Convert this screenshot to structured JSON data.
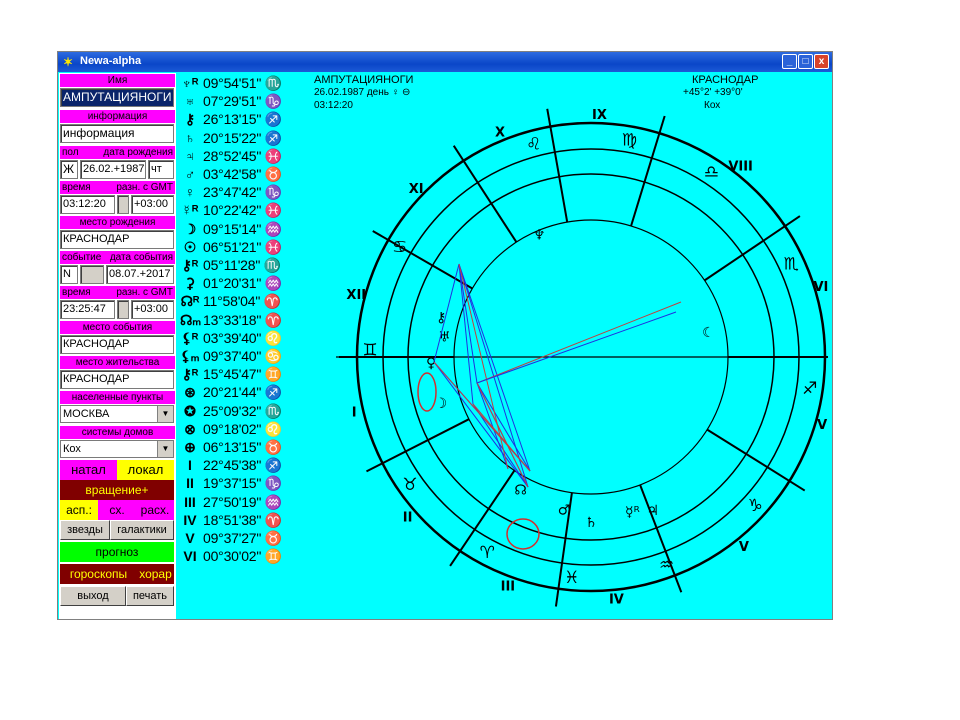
{
  "window": {
    "title": "Newa-alpha",
    "min_label": "_",
    "max_label": "□",
    "close_label": "x"
  },
  "left": {
    "name_label": "Имя",
    "name_value": "АМПУТАЦИЯНОГИ",
    "info_label": "информация",
    "info_value": "информация",
    "birth_label_sex": "пол",
    "birth_label_date": "дата рождения",
    "sex_value": "Ж",
    "date_value": "26.02.+1987",
    "weekday_value": "чт",
    "time_label": "время",
    "gmt_label": "разн. с GMT",
    "time_value": "03:12:20",
    "gmt_value": "+03:00",
    "birthplace_label": "место рождения",
    "birthplace_value": "КРАСНОДАР",
    "event_label": "событие",
    "event_date_label": "дата события",
    "event_value": "N",
    "event_date_value": "08.07.+2017",
    "event_time_label": "время",
    "event_gmt_label": "разн. с GMT",
    "event_time_value": "23:25:47",
    "event_gmt_value": "+03:00",
    "eventplace_label": "место события",
    "eventplace_value": "КРАСНОДАР",
    "residence_label": "место жительства",
    "residence_value": "КРАСНОДАР",
    "settlements_label": "населенные пункты",
    "settlements_value": "МОСКВА",
    "houses_label": "системы домов",
    "houses_value": "Кох",
    "natal": "натал",
    "local": "локал",
    "rotation": "вращение+",
    "asp": "асп.:",
    "sx": "сх.",
    "rasx": "расх.",
    "stars": "звезды",
    "galaxies": "галактики",
    "forecast": "прогноз",
    "horoscopes": "гороскопы",
    "horar": "хорар",
    "exit": "выход",
    "print": "печать"
  },
  "planets": [
    {
      "glyph": "♆ᴿ",
      "value": "09°54'51\" ♏"
    },
    {
      "glyph": "♅",
      "value": "07°29'51\" ♑"
    },
    {
      "glyph": "⚷",
      "value": "26°13'15\" ♐"
    },
    {
      "glyph": "♄",
      "value": "20°15'22\" ♐"
    },
    {
      "glyph": "♃",
      "value": "28°52'45\" ♓"
    },
    {
      "glyph": "♂",
      "value": "03°42'58\" ♉"
    },
    {
      "glyph": "♀",
      "value": "23°47'42\" ♑"
    },
    {
      "glyph": "☿ᴿ",
      "value": "10°22'42\" ♓"
    },
    {
      "glyph": "☽",
      "value": "09°15'14\" ♒"
    },
    {
      "glyph": "☉",
      "value": "06°51'21\" ♓"
    },
    {
      "glyph": "⚷ᴿ",
      "value": "05°11'28\" ♏"
    },
    {
      "glyph": "⚳",
      "value": "01°20'31\" ♒"
    },
    {
      "glyph": "☊ᴿ",
      "value": "11°58'04\" ♈"
    },
    {
      "glyph": "☊ₘ",
      "value": "13°33'18\" ♈"
    },
    {
      "glyph": "⚸ᴿ",
      "value": "03°39'40\" ♌"
    },
    {
      "glyph": "⚸ₘ",
      "value": "09°37'40\" ♋"
    },
    {
      "glyph": "⚷ᴿ",
      "value": "15°45'47\" ♊"
    },
    {
      "glyph": "⊛",
      "value": "20°21'44\" ♐"
    },
    {
      "glyph": "✪",
      "value": "25°09'32\" ♏"
    },
    {
      "glyph": "⊗",
      "value": "09°18'02\" ♌"
    },
    {
      "glyph": "⊕",
      "value": "06°13'15\" ♉"
    },
    {
      "glyph": "I",
      "value": "22°45'38\" ♐"
    },
    {
      "glyph": "II",
      "value": "19°37'15\" ♑"
    },
    {
      "glyph": "III",
      "value": "27°50'19\" ♒"
    },
    {
      "glyph": "IV",
      "value": "18°51'38\" ♈"
    },
    {
      "glyph": "V",
      "value": "09°37'27\" ♉"
    },
    {
      "glyph": "VI",
      "value": "00°30'02\" ♊"
    }
  ],
  "chart_header": {
    "name": "АМПУТАЦИЯНОГИ",
    "date_line": "26.02.1987 день ♀ ⊖",
    "time": "03:12:20",
    "city": "КРАСНОДАР",
    "coords": "+45°2' +39°0'",
    "house_system": "Кох"
  },
  "wheel": {
    "house_numerals": [
      "I",
      "II",
      "III",
      "IV",
      "V",
      "VI",
      "VII",
      "VIII",
      "IX",
      "X",
      "XI",
      "XII"
    ],
    "outer_glyphs": [
      "♌",
      "♍",
      "♎",
      "♏",
      "♐",
      "♑",
      "♒",
      "♓",
      "♈",
      "♉",
      "♊",
      "♋"
    ],
    "inner_glyphs": [
      "♆",
      "☾",
      "♅",
      "♀",
      "☽",
      "☊",
      "♂",
      "☿ᴿ",
      "♃",
      "♄",
      "⚷"
    ]
  }
}
